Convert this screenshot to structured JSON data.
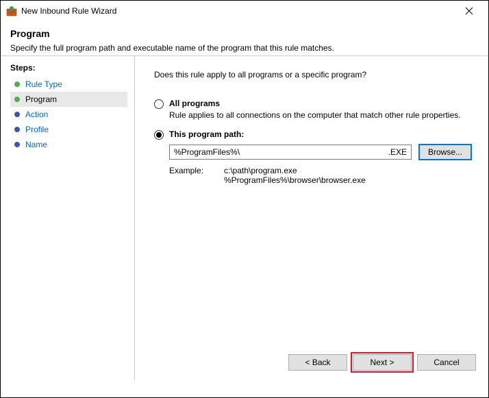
{
  "window": {
    "title": "New Inbound Rule Wizard"
  },
  "header": {
    "title": "Program",
    "subtitle": "Specify the full program path and executable name of the program that this rule matches."
  },
  "sidebar": {
    "title": "Steps:",
    "items": [
      {
        "label": "Rule Type"
      },
      {
        "label": "Program"
      },
      {
        "label": "Action"
      },
      {
        "label": "Profile"
      },
      {
        "label": "Name"
      }
    ]
  },
  "main": {
    "question": "Does this rule apply to all programs or a specific program?",
    "allPrograms": {
      "label": "All programs",
      "desc": "Rule applies to all connections on the computer that match other rule properties."
    },
    "thisPath": {
      "label": "This program path:",
      "value": "%ProgramFiles%\\",
      "suffix": ".EXE",
      "browse": "Browse..."
    },
    "example": {
      "label": "Example:",
      "line1": "c:\\path\\program.exe",
      "line2": "%ProgramFiles%\\browser\\browser.exe"
    }
  },
  "footer": {
    "back": "< Back",
    "next": "Next >",
    "cancel": "Cancel"
  }
}
